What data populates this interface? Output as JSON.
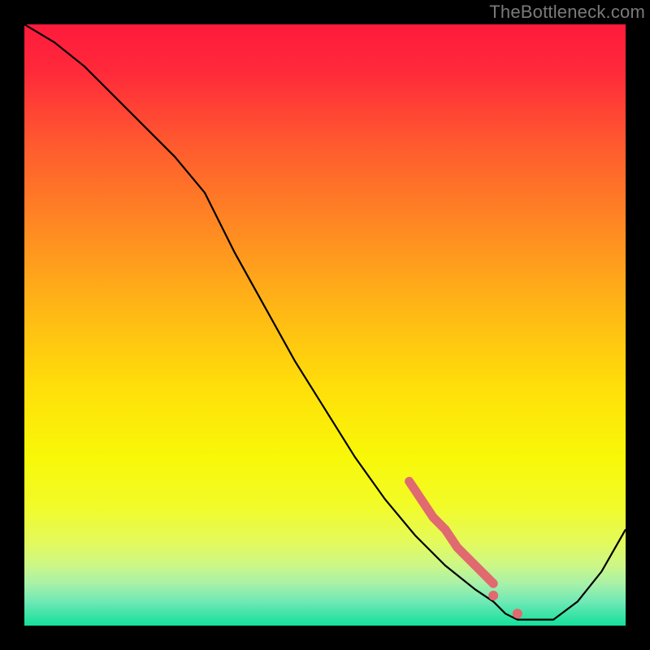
{
  "watermark": "TheBottleneck.com",
  "chart_data": {
    "type": "line",
    "title": "",
    "xlabel": "",
    "ylabel": "",
    "xlim": [
      0,
      100
    ],
    "ylim": [
      0,
      100
    ],
    "grid": false,
    "legend": false,
    "description": "Bottleneck curve over a red-to-green vertical gradient. The black curve starts near 100 at x=0, descends, reaches a minimum near x≈82, then rises toward the right edge. A thick pink segment highlights a portion of the descending limb (~x=64–78) with two small pink dots near the trough.",
    "series": [
      {
        "name": "bottleneck-curve",
        "x": [
          0,
          5,
          10,
          15,
          20,
          25,
          30,
          35,
          40,
          45,
          50,
          55,
          60,
          65,
          70,
          75,
          78,
          80,
          82,
          85,
          88,
          92,
          96,
          100
        ],
        "y": [
          100,
          97,
          93,
          88,
          83,
          78,
          72,
          62,
          53,
          44,
          36,
          28,
          21,
          15,
          10,
          6,
          4,
          2,
          1,
          1,
          1,
          4,
          9,
          16
        ]
      }
    ],
    "highlight_segment": {
      "x": [
        64,
        66,
        68,
        70,
        72,
        74,
        76,
        78
      ],
      "y": [
        24,
        21,
        18,
        16,
        13,
        11,
        9,
        7
      ]
    },
    "highlight_dots": [
      {
        "x": 78,
        "y": 5
      },
      {
        "x": 82,
        "y": 2
      }
    ],
    "gradient_stops": [
      {
        "offset": 0.0,
        "color": "#ff1a3c"
      },
      {
        "offset": 0.08,
        "color": "#ff2a3a"
      },
      {
        "offset": 0.2,
        "color": "#ff5a2f"
      },
      {
        "offset": 0.34,
        "color": "#ff8a22"
      },
      {
        "offset": 0.48,
        "color": "#ffb915"
      },
      {
        "offset": 0.6,
        "color": "#ffde0a"
      },
      {
        "offset": 0.72,
        "color": "#f8f808"
      },
      {
        "offset": 0.8,
        "color": "#f2fb28"
      },
      {
        "offset": 0.86,
        "color": "#e4fa5a"
      },
      {
        "offset": 0.9,
        "color": "#ccf787"
      },
      {
        "offset": 0.93,
        "color": "#a8f1a8"
      },
      {
        "offset": 0.96,
        "color": "#6fe9b5"
      },
      {
        "offset": 1.0,
        "color": "#14df9b"
      }
    ]
  }
}
